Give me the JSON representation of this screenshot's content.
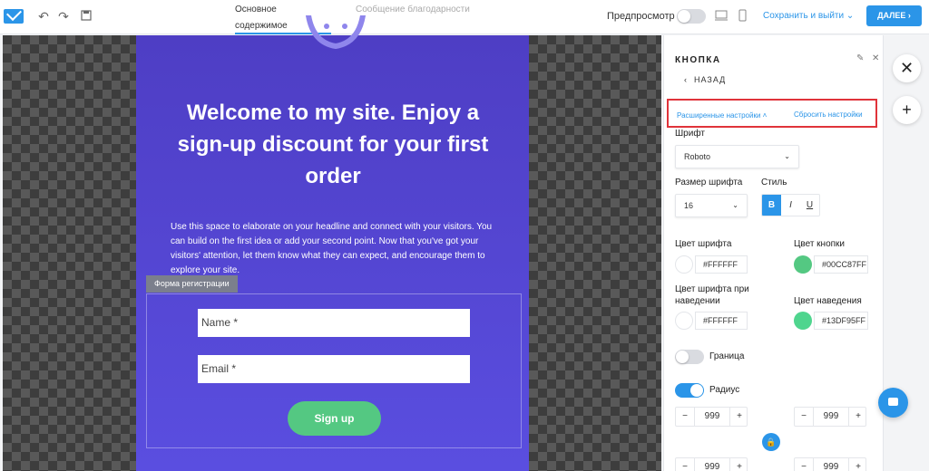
{
  "toolbar": {
    "tabs": [
      {
        "label": "Основное содержимое",
        "active": true
      },
      {
        "label": "Сообщение благодарности",
        "active": false
      }
    ],
    "preview_label": "Предпросмотр",
    "save_exit": "Сохранить и выйти",
    "next": "ДАЛЕЕ",
    "icons": [
      "undo-icon",
      "redo-icon",
      "save-icon",
      "desktop-icon",
      "mobile-icon"
    ]
  },
  "canvas": {
    "headline": "Welcome to my site. Enjoy a sign-up discount for your first order",
    "paragraph": "Use this space to elaborate on your headline and connect with your visitors. You can build on the first idea or add your second point. Now that you've got your visitors' attention, let them know what they can expect, and encourage them to explore your site.",
    "form_tag": "Форма регистрации",
    "name_placeholder": "Name *",
    "email_placeholder": "Email *",
    "signup_label": "Sign up"
  },
  "panel": {
    "title": "КНОПКА",
    "back": "НАЗАД",
    "advanced": "Расширенные настройки",
    "reset": "Сбросить настройки",
    "font_label": "Шрифт",
    "font_value": "Roboto",
    "font_size_label": "Размер шрифта",
    "font_size_value": "16",
    "style_label": "Стиль",
    "style_bold": "B",
    "style_italic": "I",
    "style_underline": "U",
    "font_color_label": "Цвет шрифта",
    "font_color_value": "#FFFFFF",
    "button_color_label": "Цвет кнопки",
    "button_color_value": "#00CC87FF",
    "hover_font_color_label": "Цвет шрифта при наведении",
    "hover_font_color_value": "#FFFFFF",
    "hover_color_label": "Цвет наведения",
    "hover_color_value": "#13DF95FF",
    "border_label": "Граница",
    "border_on": false,
    "radius_label": "Радиус",
    "radius_on": true,
    "radius_values": [
      "999",
      "999",
      "999",
      "999"
    ]
  },
  "colors": {
    "accent": "#2b95e8",
    "hero": "#4e3ec4",
    "button_green": "#54c882",
    "highlight": "#e0333a"
  }
}
